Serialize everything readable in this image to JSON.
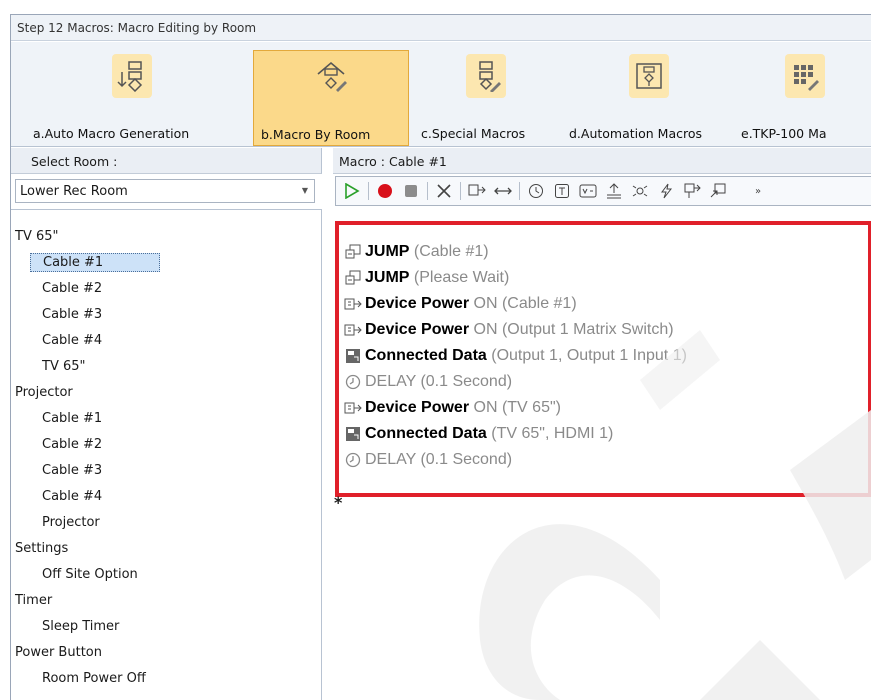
{
  "window": {
    "title": "Step 12 Macros: Macro Editing by Room"
  },
  "ribbon": {
    "buttons": [
      {
        "label": "a.Auto Macro Generation",
        "icon": "auto-macro-icon",
        "active": false
      },
      {
        "label": "b.Macro By Room",
        "icon": "macro-by-room-icon",
        "active": true
      },
      {
        "label": "c.Special Macros",
        "icon": "special-macros-icon",
        "active": false
      },
      {
        "label": "d.Automation Macros",
        "icon": "automation-macros-icon",
        "active": false
      },
      {
        "label": "e.TKP-100 Ma",
        "icon": "tkp100-macros-icon",
        "active": false
      }
    ]
  },
  "left": {
    "header": "Select Room :",
    "room_select": "Lower Rec Room",
    "tree": [
      {
        "label": "TV 65\"",
        "type": "group"
      },
      {
        "label": "Cable #1",
        "type": "child",
        "selected": true
      },
      {
        "label": "Cable #2",
        "type": "child"
      },
      {
        "label": "Cable #3",
        "type": "child"
      },
      {
        "label": "Cable #4",
        "type": "child"
      },
      {
        "label": "TV 65\"",
        "type": "child"
      },
      {
        "label": "Projector",
        "type": "group"
      },
      {
        "label": "Cable #1",
        "type": "child"
      },
      {
        "label": "Cable #2",
        "type": "child"
      },
      {
        "label": "Cable #3",
        "type": "child"
      },
      {
        "label": "Cable #4",
        "type": "child"
      },
      {
        "label": "Projector",
        "type": "child"
      },
      {
        "label": "Settings",
        "type": "group"
      },
      {
        "label": "Off Site Option",
        "type": "child"
      },
      {
        "label": "Timer",
        "type": "group"
      },
      {
        "label": "Sleep Timer",
        "type": "child"
      },
      {
        "label": "Power Button",
        "type": "group"
      },
      {
        "label": "Room Power Off",
        "type": "child"
      }
    ]
  },
  "right": {
    "header": "Macro : Cable #1",
    "toolbar": [
      "play-icon",
      "record-icon",
      "stop-icon",
      "delete-icon",
      "device-cmd-icon",
      "swap-icon",
      "clock-add-icon",
      "text-icon",
      "variable-icon",
      "upload-icon",
      "ir-icon",
      "flash-icon",
      "port-icon",
      "jump-icon",
      "overflow-icon"
    ],
    "macro_lines": [
      {
        "icon": "jump-icon",
        "keyword": "JUMP",
        "arg": " (Cable #1)"
      },
      {
        "icon": "jump-icon",
        "keyword": "JUMP",
        "arg": " (Please Wait)"
      },
      {
        "icon": "device-power-icon",
        "keyword": "Device Power",
        "arg": " ON (Cable #1)"
      },
      {
        "icon": "device-power-icon",
        "keyword": "Device Power",
        "arg": " ON (Output 1 Matrix Switch)"
      },
      {
        "icon": "connected-data-icon",
        "keyword": "Connected Data",
        "arg": " (Output 1, Output 1 Input 1)"
      },
      {
        "icon": "delay-icon",
        "keyword": "",
        "arg": "DELAY (0.1 Second)"
      },
      {
        "icon": "device-power-icon",
        "keyword": "Device Power",
        "arg": " ON (TV 65\")"
      },
      {
        "icon": "connected-data-icon",
        "keyword": "Connected Data",
        "arg": " (TV 65\", HDMI 1)"
      },
      {
        "icon": "delay-icon",
        "keyword": "",
        "arg": "DELAY (0.1 Second)"
      }
    ],
    "end_marker": "*"
  },
  "colors": {
    "highlight_border": "#e0202a",
    "active_ribbon": "#fbd98a",
    "selection": "#cde2f8"
  }
}
